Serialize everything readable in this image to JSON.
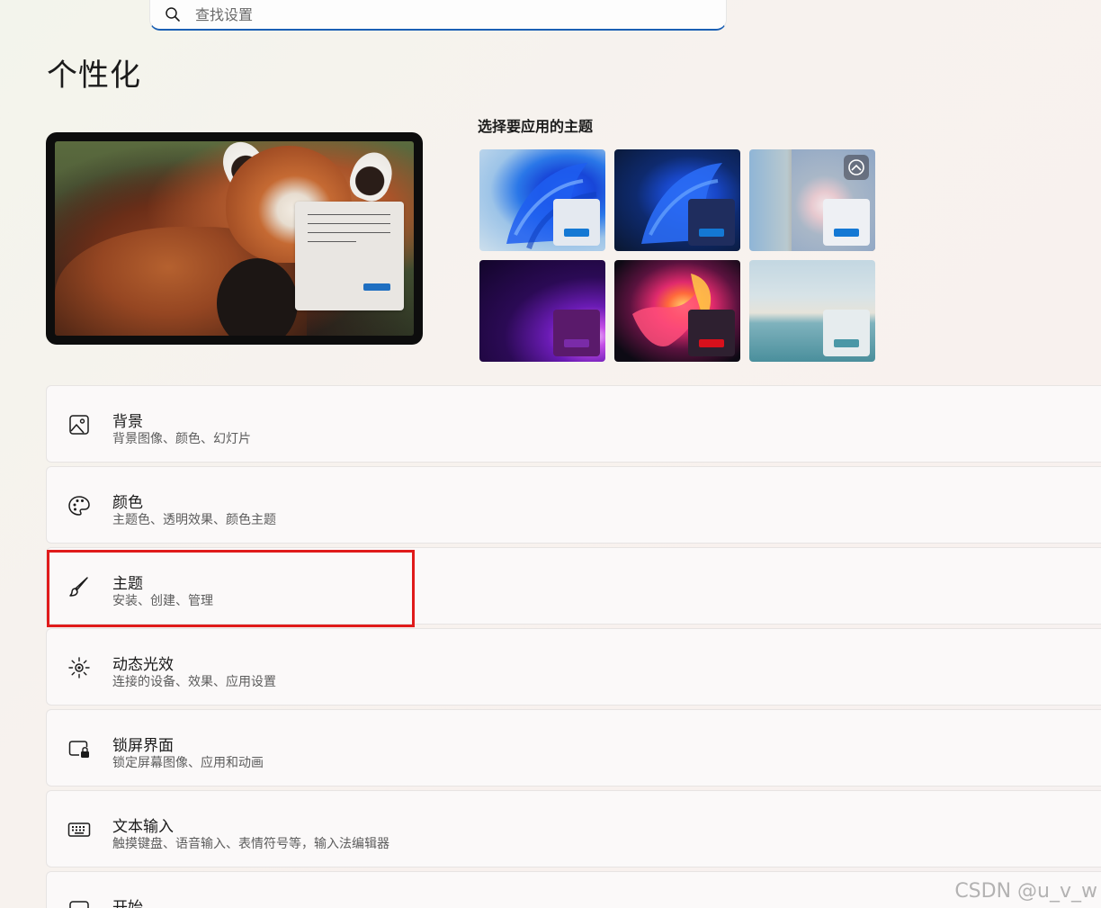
{
  "search": {
    "placeholder": "查找设置"
  },
  "page": {
    "title": "个性化"
  },
  "themes": {
    "heading": "选择要应用的主题",
    "items": [
      {
        "name": "theme-windows-light",
        "swatch": "#e4e9f0",
        "accent": "#1478d4"
      },
      {
        "name": "theme-windows-dark",
        "swatch": "#1f2d5e",
        "accent": "#1478d4"
      },
      {
        "name": "theme-spotlight",
        "swatch": "#eef0f4",
        "accent": "#1478d4",
        "badge_icon": "spotlight-icon"
      },
      {
        "name": "theme-glow",
        "swatch": "#5a1a6b",
        "accent": "#7a2ba8"
      },
      {
        "name": "theme-captured-motion",
        "swatch": "#2e2030",
        "accent": "#d8101c"
      },
      {
        "name": "theme-flow",
        "swatch": "#e6ecee",
        "accent": "#4a97a6"
      }
    ]
  },
  "settings": [
    {
      "title": "背景",
      "subtitle": "背景图像、颜色、幻灯片",
      "icon": "image-icon"
    },
    {
      "title": "颜色",
      "subtitle": "主题色、透明效果、颜色主题",
      "icon": "palette-icon"
    },
    {
      "title": "主题",
      "subtitle": "安装、创建、管理",
      "icon": "brush-icon"
    },
    {
      "title": "动态光效",
      "subtitle": "连接的设备、效果、应用设置",
      "icon": "sparkle-icon"
    },
    {
      "title": "锁屏界面",
      "subtitle": "锁定屏幕图像、应用和动画",
      "icon": "lock-screen-icon"
    },
    {
      "title": "文本输入",
      "subtitle": "触摸键盘、语音输入、表情符号等，输入法编辑器",
      "icon": "keyboard-icon"
    },
    {
      "title": "开始",
      "subtitle": "",
      "icon": "start-icon"
    }
  ],
  "watermark": "CSDN @u_v_w"
}
